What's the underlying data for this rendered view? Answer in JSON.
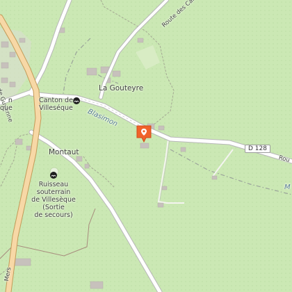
{
  "map": {
    "labels": {
      "route_guyenne": "Route de Guyenne",
      "route_carr": "Route des Carr",
      "la_gouteyre": "La Gouteyre",
      "canton": "Canton de\nVilleséque",
      "canton_partial": "n\nque",
      "blasimon": "Blasimon",
      "d128": "D 128",
      "rou": "Rou",
      "montaut": "Montaut",
      "ruisseau": "Ruisseau\nsouterrain\nde Villesèque\n(Sortie\nde secours)",
      "mers": "Mers",
      "m": "M"
    },
    "icons": {
      "location_pin": "map-pin-icon",
      "spring_1": "spring-icon",
      "spring_2": "spring-icon"
    },
    "colors": {
      "background": "#cbe8b4",
      "road_fill": "#ffffff",
      "road_casing": "#b7b7b7",
      "primary_road": "#f7d8a6",
      "pin": "#f0622a",
      "boundary": "#a68a7c",
      "track": "#9aa39a",
      "building": "#c7c1bc"
    }
  }
}
